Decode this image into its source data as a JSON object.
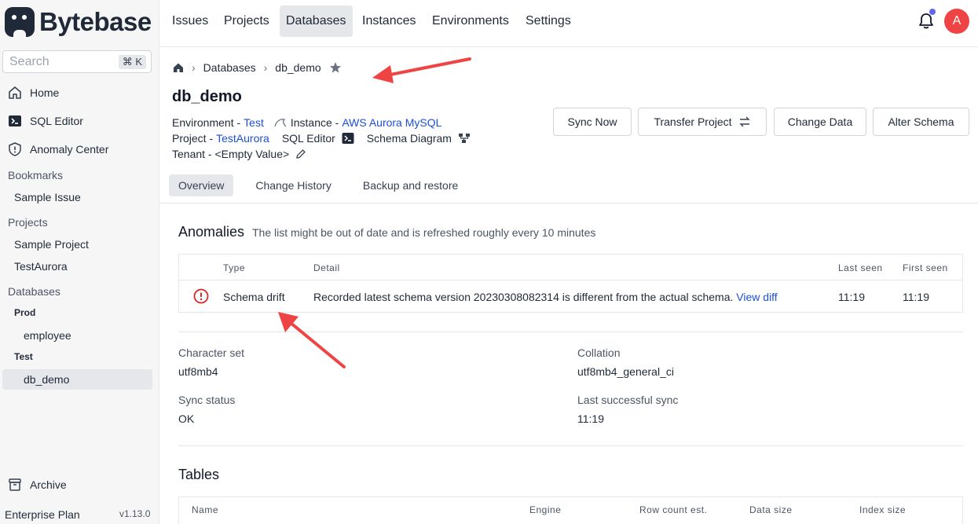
{
  "brand": {
    "name": "Bytebase"
  },
  "sidebar": {
    "search": {
      "placeholder": "Search",
      "shortcut": "⌘ K"
    },
    "main_items": [
      {
        "label": "Home",
        "icon": "home-icon"
      },
      {
        "label": "SQL Editor",
        "icon": "terminal-icon"
      },
      {
        "label": "Anomaly Center",
        "icon": "shield-icon"
      }
    ],
    "bookmarks": {
      "label": "Bookmarks",
      "items": [
        "Sample Issue"
      ]
    },
    "projects": {
      "label": "Projects",
      "items": [
        "Sample Project",
        "TestAurora"
      ]
    },
    "databases": {
      "label": "Databases",
      "envs": [
        {
          "name": "Prod",
          "dbs": [
            "employee"
          ]
        },
        {
          "name": "Test",
          "dbs": [
            "db_demo"
          ]
        }
      ]
    },
    "archive": {
      "label": "Archive",
      "icon": "archive-icon"
    },
    "plan": "Enterprise Plan",
    "version": "v1.13.0"
  },
  "topnav": {
    "items": [
      "Issues",
      "Projects",
      "Databases",
      "Instances",
      "Environments",
      "Settings"
    ],
    "active": "Databases",
    "avatar_initial": "A"
  },
  "breadcrumb": {
    "section": "Databases",
    "current": "db_demo"
  },
  "database": {
    "title": "db_demo",
    "environment_label": "Environment -",
    "environment_value": "Test",
    "instance_label": "Instance -",
    "instance_value": "AWS Aurora MySQL",
    "project_label": "Project -",
    "project_value": "TestAurora",
    "sql_editor_label": "SQL Editor",
    "schema_diagram_label": "Schema Diagram",
    "tenant_label": "Tenant - <Empty Value>"
  },
  "actions": {
    "sync_now": "Sync Now",
    "transfer_project": "Transfer Project",
    "change_data": "Change Data",
    "alter_schema": "Alter Schema"
  },
  "tabs": [
    "Overview",
    "Change History",
    "Backup and restore"
  ],
  "anomalies": {
    "title": "Anomalies",
    "subtitle": "The list might be out of date and is refreshed roughly every 10 minutes",
    "headers": {
      "type": "Type",
      "detail": "Detail",
      "last_seen": "Last seen",
      "first_seen": "First seen"
    },
    "rows": [
      {
        "type": "Schema drift",
        "detail": "Recorded latest schema version 20230308082314 is different from the actual schema.",
        "link": "View diff",
        "last_seen": "11:19",
        "first_seen": "11:19"
      }
    ]
  },
  "info": {
    "character_set_label": "Character set",
    "character_set_value": "utf8mb4",
    "collation_label": "Collation",
    "collation_value": "utf8mb4_general_ci",
    "sync_status_label": "Sync status",
    "sync_status_value": "OK",
    "last_sync_label": "Last successful sync",
    "last_sync_value": "11:19"
  },
  "tables": {
    "title": "Tables",
    "headers": {
      "name": "Name",
      "engine": "Engine",
      "row_count": "Row count est.",
      "data_size": "Data size",
      "index_size": "Index size"
    }
  },
  "colors": {
    "link": "#1d4ed8",
    "annotation": "#ef4444",
    "avatar": "#ef4444",
    "badge": "#6366f1"
  }
}
